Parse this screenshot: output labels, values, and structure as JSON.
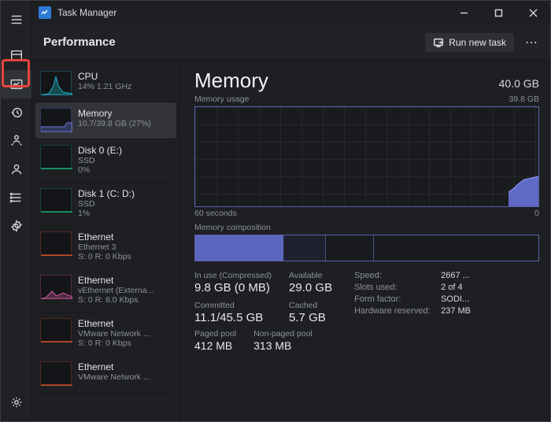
{
  "app_title": "Task Manager",
  "header": {
    "title": "Performance",
    "run_label": "Run new task"
  },
  "rail_icons": [
    "hamburger",
    "processes",
    "performance",
    "history",
    "startup",
    "users",
    "details",
    "services"
  ],
  "sidebar": [
    {
      "name": "CPU",
      "sub1": "14%  1.21 GHz",
      "sub2": "",
      "color": "#1fb0c4",
      "spark": "cpu"
    },
    {
      "name": "Memory",
      "sub1": "10.7/39.8 GB (27%)",
      "sub2": "",
      "color": "#6d7adf",
      "spark": "mem",
      "selected": true
    },
    {
      "name": "Disk 0 (E:)",
      "sub1": "SSD",
      "sub2": "0%",
      "color": "#1aa36e",
      "spark": "flat"
    },
    {
      "name": "Disk 1 (C: D:)",
      "sub1": "SSD",
      "sub2": "1%",
      "color": "#1aa36e",
      "spark": "flat"
    },
    {
      "name": "Ethernet",
      "sub1": "Ethernet 3",
      "sub2": "S: 0  R: 0 Kbps",
      "color": "#c94f2d",
      "spark": "flat"
    },
    {
      "name": "Ethernet",
      "sub1": "vEthernet (Externa...",
      "sub2": "S: 0  R: 8.0 Kbps",
      "color": "#d05a9a",
      "spark": "net"
    },
    {
      "name": "Ethernet",
      "sub1": "VMware Network ...",
      "sub2": "S: 0  R: 0 Kbps",
      "color": "#c94f2d",
      "spark": "flat"
    },
    {
      "name": "Ethernet",
      "sub1": "VMware Network ...",
      "sub2": "",
      "color": "#c94f2d",
      "spark": "flat"
    }
  ],
  "memory": {
    "title": "Memory",
    "capacity": "40.0 GB",
    "usage_label": "Memory usage",
    "usage_max": "39.8 GB",
    "x_left": "60 seconds",
    "x_right": "0",
    "composition_label": "Memory composition",
    "stats": {
      "in_use_label": "In use (Compressed)",
      "in_use": "9.8 GB (0 MB)",
      "available_label": "Available",
      "available": "29.0 GB",
      "committed_label": "Committed",
      "committed": "11.1/45.5 GB",
      "cached_label": "Cached",
      "cached": "5.7 GB",
      "paged_label": "Paged pool",
      "paged": "412 MB",
      "nonpaged_label": "Non-paged pool",
      "nonpaged": "313 MB"
    },
    "details": {
      "speed_k": "Speed:",
      "speed_v": "2667 ...",
      "slots_k": "Slots used:",
      "slots_v": "2 of 4",
      "form_k": "Form factor:",
      "form_v": "SODI...",
      "hw_k": "Hardware reserved:",
      "hw_v": "237 MB"
    }
  },
  "chart_data": {
    "type": "area",
    "title": "Memory usage",
    "ylabel": "GB",
    "ylim": [
      0,
      39.8
    ],
    "x": [
      "-60s",
      "0s"
    ],
    "series": [
      {
        "name": "Memory",
        "values_note": "rises from ~0 to ~10.7 GB near right edge",
        "end_value": 10.7
      }
    ]
  }
}
